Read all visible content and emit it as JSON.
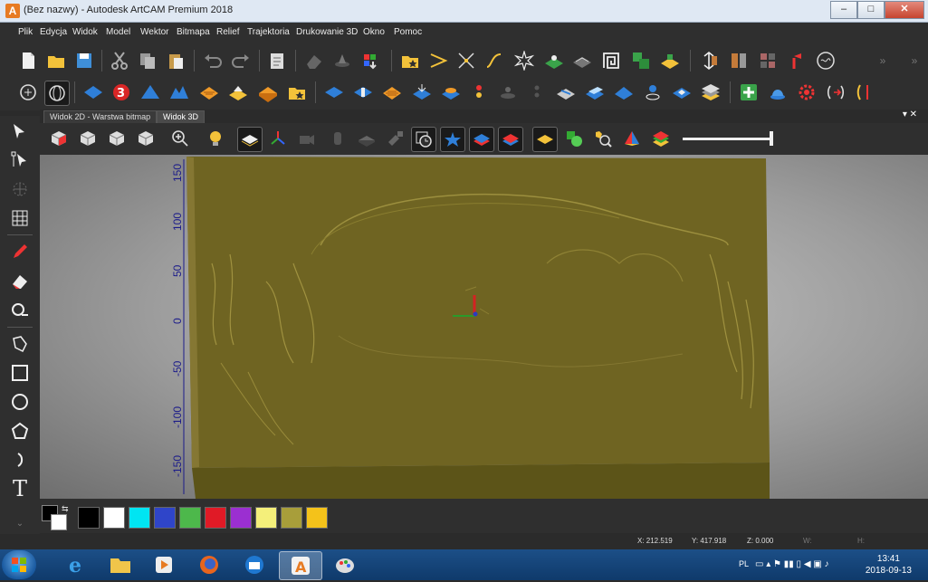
{
  "window": {
    "title": "(Bez nazwy) - Autodesk ArtCAM Premium 2018",
    "icon_letter": "A",
    "minimize": "–",
    "maximize": "□",
    "close": "✕"
  },
  "menu": [
    "Plik",
    "Edycja",
    "Widok",
    "Model",
    "Wektor",
    "Bitmapa",
    "Relief",
    "Trajektoria",
    "Drukowanie 3D",
    "Okno",
    "Pomoc"
  ],
  "tabs": [
    "Widok 2D - Warstwa bitmap",
    "Widok 3D"
  ],
  "tabs_close": "▾ ✕",
  "axis_ticks": [
    "150",
    "100",
    "50",
    "0",
    "-50",
    "-100",
    "-150"
  ],
  "colors": {
    "accent": "#e77b23",
    "relief": "#6f6422",
    "axis": "#1b1b8a"
  },
  "palette": [
    "#000000",
    "#ffffff",
    "#00e5f2",
    "#2f45c9",
    "#4db84b",
    "#e01a26",
    "#9b2fd1",
    "#f4ef7a",
    "#a89e3a",
    "#f4c21a"
  ],
  "status": {
    "x": "X: 212.519",
    "y": "Y: 417.918",
    "z": "Z: 0.000",
    "w": "W:",
    "h": "H:"
  },
  "taskbar": {
    "lang": "PL",
    "time": "13:41",
    "date": "2018-09-13"
  },
  "icons": {
    "toolbar1": [
      "new-file-icon",
      "open-folder-icon",
      "save-icon",
      "cut-icon",
      "copy-icon",
      "paste-icon",
      "undo-icon",
      "redo-icon",
      "notes-icon",
      "eraser-icon",
      "relief-sculpt-icon",
      "export-icon",
      "favorite-folder-icon",
      "vector-offset-icon",
      "node-edit-icon",
      "curve-icon",
      "star-shape-icon",
      "relief-add-icon",
      "relief-smooth-icon",
      "spiral-icon",
      "vector-group-icon",
      "relief-raise-icon",
      "measure-icon",
      "split-view-icon",
      "bitmap-grid-icon",
      "wand-icon",
      "toolpath-icon"
    ],
    "toolbar2": [
      "zoom-region-icon",
      "sphere-icon",
      "plane-icon",
      "text-3d-icon",
      "mountain-icon",
      "mountain2-icon",
      "texture-icon",
      "relief-layer-icon",
      "block-icon",
      "star-folder-icon",
      "flat-relief-icon",
      "extrude-icon",
      "grid-relief-icon",
      "relief-ops-icon",
      "relief-combine-icon",
      "dots-icon",
      "relief-tool-icon",
      "dots2-icon",
      "relief-cut-icon",
      "relief-lift-icon",
      "relief-blend-icon",
      "relief-spin-icon",
      "relief-flat-icon",
      "layers-icon",
      "add-green-icon",
      "dome-icon",
      "gear-icon",
      "flip-icon",
      "relief-bend-icon"
    ],
    "view": [
      "cube-iso-icon",
      "cube-front-icon",
      "cube-side-icon",
      "cube-top-icon",
      "zoom-icon",
      "light-bulb-icon",
      "layer-view-icon",
      "axes-icon",
      "camera-icon",
      "cylinder-icon",
      "render-icon",
      "tool-icon",
      "clock-icon",
      "star-blue-icon",
      "layers-blue-icon",
      "layers-red-icon",
      "relief-yellow-icon",
      "shapes-green-icon",
      "zoom-colour-icon",
      "pyramid-icon",
      "multi-layer-icon"
    ],
    "left": [
      "select-arrow-icon",
      "node-select-icon",
      "transform-icon",
      "mesh-icon",
      "pencil-icon",
      "eraser-tool-icon",
      "measure-tool-icon",
      "lasso-icon",
      "rectangle-icon",
      "circle-icon",
      "polygon-icon",
      "arc-icon",
      "text-icon"
    ]
  }
}
